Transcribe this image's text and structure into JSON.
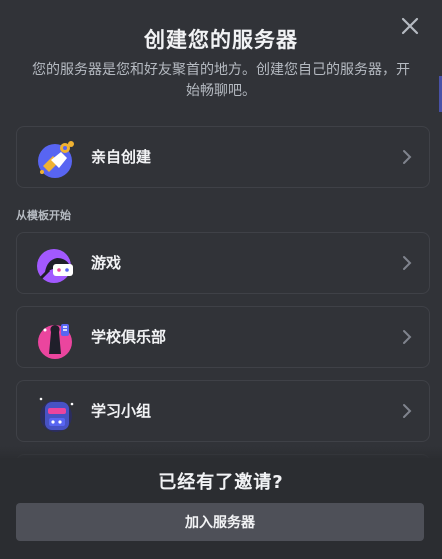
{
  "modal": {
    "title": "创建您的服务器",
    "subtitle": "您的服务器是您和好友聚首的地方。创建您自己的服务器，开始畅聊吧。",
    "close_icon": "close-icon"
  },
  "create_own": {
    "label": "亲自创建",
    "icon": "create-server-icon"
  },
  "templates": {
    "section_label": "从模板开始",
    "items": [
      {
        "label": "游戏",
        "icon": "gaming-icon"
      },
      {
        "label": "学校俱乐部",
        "icon": "school-club-icon"
      },
      {
        "label": "学习小组",
        "icon": "study-group-icon"
      }
    ]
  },
  "footer": {
    "title": "已经有了邀请?",
    "join_button": "加入服务器"
  },
  "colors": {
    "modal_bg": "#313338",
    "footer_bg": "#2b2d31",
    "button_bg": "#4e5058",
    "border": "#3f4147"
  }
}
